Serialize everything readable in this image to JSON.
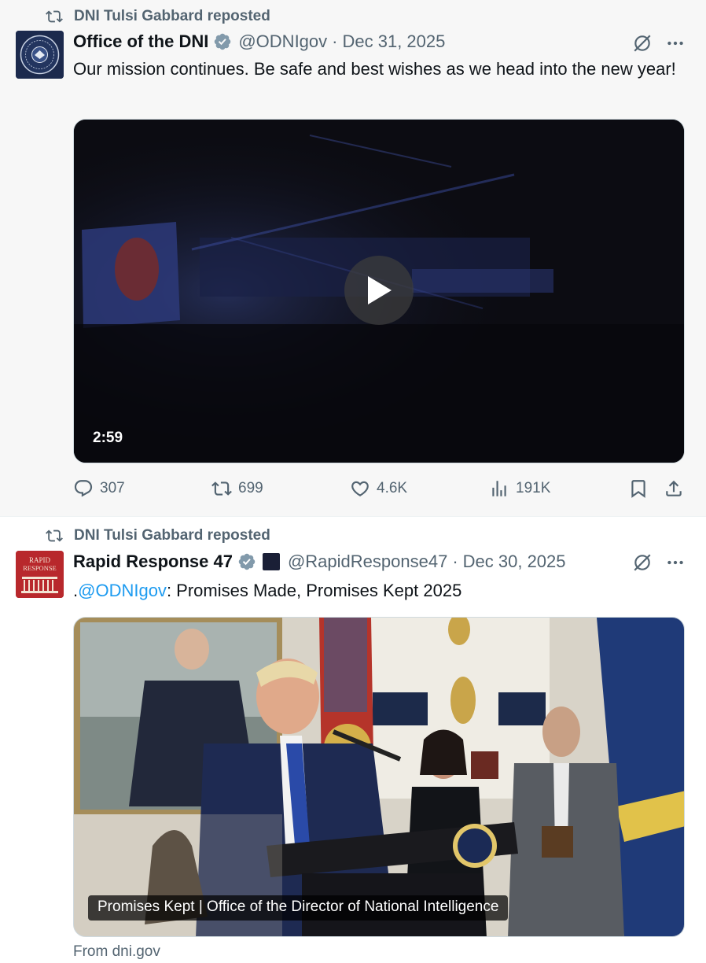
{
  "tweets": [
    {
      "repost_label": "DNI Tulsi Gabbard reposted",
      "name": "Office of the DNI",
      "handle": "@ODNIgov",
      "separator": "·",
      "date": "Dec 31, 2025",
      "text": "Our mission continues. Be safe and best wishes as we head into the new year!",
      "media": {
        "type": "video",
        "duration": "2:59"
      },
      "stats": {
        "replies": "307",
        "reposts": "699",
        "likes": "4.6K",
        "views": "191K"
      }
    },
    {
      "repost_label": "DNI Tulsi Gabbard reposted",
      "name": "Rapid Response 47",
      "handle": "@RapidResponse47",
      "separator": "·",
      "date": "Dec 30, 2025",
      "text_prefix": ".",
      "mention": "@ODNIgov",
      "text_rest": ": Promises Made, Promises Kept 2025",
      "avatar_text": {
        "line1": "RAPID",
        "line2": "RESPONSE"
      },
      "card": {
        "caption": "Promises Kept | Office of the Director of National Intelligence",
        "source": "From dni.gov"
      }
    }
  ],
  "colors": {
    "accent": "#1d9bf0",
    "muted": "#536471",
    "text": "#0f1419",
    "verified": "#829aab"
  },
  "icons": [
    "repost-icon",
    "verified-badge-icon",
    "grok-icon",
    "more-icon",
    "play-icon",
    "reply-icon",
    "like-icon",
    "views-icon",
    "bookmark-icon",
    "share-icon"
  ]
}
